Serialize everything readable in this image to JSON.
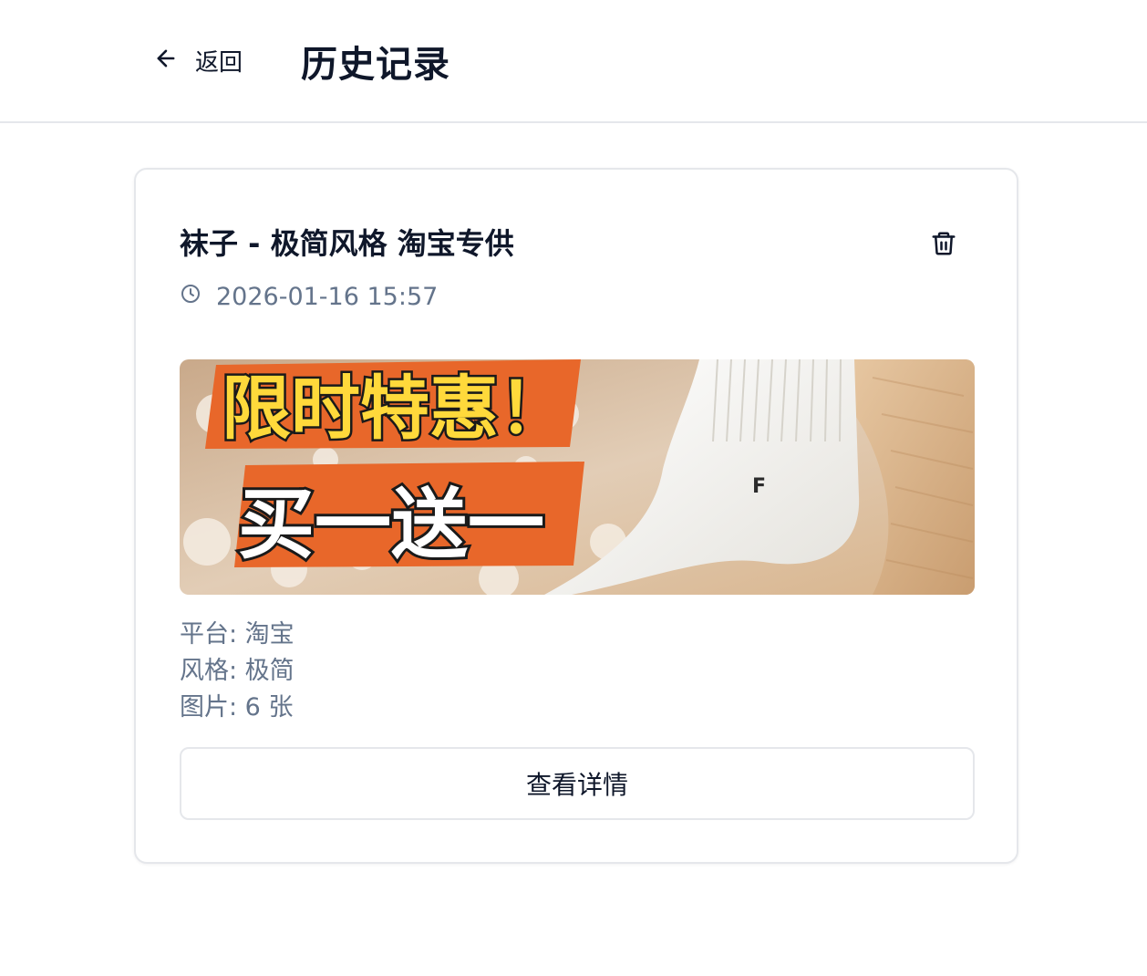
{
  "header": {
    "back_label": "返回",
    "title": "历史记录"
  },
  "record": {
    "title": "袜子 - 极简风格 淘宝专供",
    "timestamp": "2026-01-16 15:57",
    "banner": {
      "headline": "限时特惠！",
      "subheadline": "买一送一",
      "sock_mark": "F"
    },
    "platform_line": "平台: 淘宝",
    "style_line": "风格: 极简",
    "images_line": "图片: 6 张",
    "detail_button_label": "查看详情"
  },
  "colors": {
    "text_primary": "#0f172a",
    "text_muted": "#64748b",
    "border": "#e5e7eb",
    "banner_orange": "#e8672a",
    "banner_yellow": "#ffd93b"
  },
  "icons": {
    "back": "arrow-left-icon",
    "delete": "trash-icon",
    "time": "clock-icon"
  }
}
